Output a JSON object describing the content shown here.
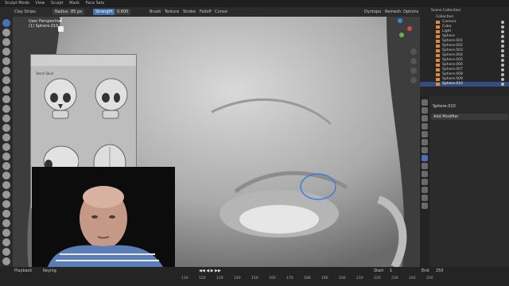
{
  "menu": [
    "Sculpt Mode",
    "View",
    "Sculpt",
    "Mask",
    "Face Sets"
  ],
  "toolbar": {
    "tool_name": "Clay Strips",
    "radius_label": "Radius",
    "radius_value": "85 px",
    "strength_label": "Strength",
    "strength_value": "0.600",
    "menus": [
      "Brush",
      "Texture",
      "Stroke",
      "Falloff",
      "Cursor"
    ],
    "right": [
      "Dyntopo",
      "Remesh",
      "Options"
    ]
  },
  "viewport": {
    "perspective": "User Perspective",
    "object": "(1) Sphere.010",
    "number": "2"
  },
  "reference": {
    "title": "Stock Skull"
  },
  "outliner": {
    "header": "Scene Collection",
    "rows": [
      "Collection",
      "Camera",
      "Cube",
      "Light",
      "Sphere",
      "Sphere.001",
      "Sphere.002",
      "Sphere.003",
      "Sphere.004",
      "Sphere.005",
      "Sphere.006",
      "Sphere.007",
      "Sphere.008",
      "Sphere.009",
      "Sphere.010"
    ],
    "selected": "Sphere.010"
  },
  "properties": {
    "object": "Sphere.010",
    "add_modifier": "Add Modifier"
  },
  "timeline": {
    "playback": "Playback",
    "keying": "Keying",
    "start_label": "Start",
    "start_value": "1",
    "end_label": "End",
    "end_value": "250",
    "frames": [
      "110",
      "120",
      "130",
      "140",
      "150",
      "160",
      "170",
      "180",
      "190",
      "200",
      "210",
      "220",
      "230",
      "240",
      "250"
    ]
  },
  "colors": {
    "accent": "#4772b3",
    "object_orange": "#e08a3c",
    "panel": "#2b2b2b"
  }
}
